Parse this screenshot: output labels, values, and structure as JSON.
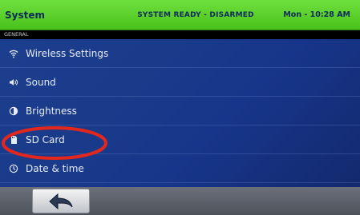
{
  "status": {
    "title": "System",
    "state": "SYSTEM READY - DISARMED",
    "datetime": "Mon - 10:28 AM"
  },
  "section": {
    "label": "GENERAL"
  },
  "menu": [
    {
      "label": "Wireless Settings",
      "icon": "wifi-icon"
    },
    {
      "label": "Sound",
      "icon": "speaker-icon"
    },
    {
      "label": "Brightness",
      "icon": "brightness-icon"
    },
    {
      "label": "SD Card",
      "icon": "sd-card-icon"
    },
    {
      "label": "Date & time",
      "icon": "clock-icon"
    }
  ],
  "bottom": {
    "back_icon": "back-arrow-icon"
  },
  "colors": {
    "status_bar": "#49c11b",
    "background": "#1a3b8a",
    "annotation": "#e3271c"
  }
}
